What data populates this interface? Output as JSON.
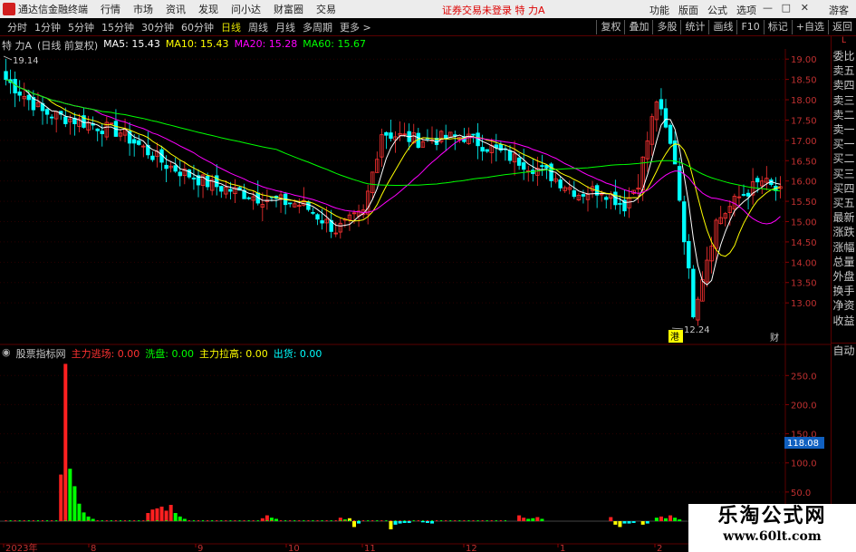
{
  "titlebar": {
    "app_title": "通达信金融终端",
    "menus": [
      "行情",
      "市场",
      "资讯",
      "发现",
      "问小达",
      "财富圈",
      "交易"
    ],
    "status": "证券交易未登录  特 力A",
    "right_menus": [
      "功能",
      "版面",
      "公式",
      "选项"
    ],
    "guest": "游客"
  },
  "toolbar": {
    "periods": [
      "分时",
      "1分钟",
      "5分钟",
      "15分钟",
      "30分钟",
      "60分钟",
      "日线",
      "周线",
      "月线",
      "多周期",
      "更多 >"
    ],
    "active_period": "日线",
    "right_tools": [
      "复权",
      "叠加",
      "多股",
      "统计",
      "画线",
      "F10",
      "标记",
      "+自选",
      "返回"
    ]
  },
  "main_chart": {
    "stock": "特 力A",
    "adjust": "(日线 前复权)",
    "ma5": "MA5: 15.43",
    "ma10": "MA10: 15.43",
    "ma20": "MA20: 15.28",
    "ma60": "MA60: 15.67",
    "high_label": "19.14",
    "low_label": "12.24",
    "finance_label": "财",
    "badge": "港",
    "price_ticks": [
      "19.00",
      "18.50",
      "18.00",
      "17.50",
      "17.00",
      "16.50",
      "16.00",
      "15.50",
      "15.00",
      "14.50",
      "14.00",
      "13.50",
      "13.00"
    ]
  },
  "sub_chart": {
    "indicator": "股票指标网",
    "main_fight": "主力逃场: 0.00",
    "wash": "洗盘: 0.00",
    "pull_up": "主力拉高: 0.00",
    "ship": "出货: 0.00",
    "ticks": [
      "250.0",
      "200.0",
      "150.0",
      "100.0",
      "50.0"
    ],
    "current_value": "118.08"
  },
  "x_axis": {
    "labels": [
      "2023年",
      "8",
      "9",
      "10",
      "11",
      "12",
      "1",
      "2"
    ]
  },
  "side_panel": {
    "top_label": "L",
    "items": [
      "委比",
      "卖五",
      "卖四",
      "卖三",
      "卖二",
      "卖一",
      "买一",
      "买二",
      "买三",
      "买四",
      "买五",
      "最新",
      "涨跌",
      "涨幅",
      "总量",
      "外盘",
      "换手",
      "净资",
      "收益"
    ],
    "bottom": "自动"
  },
  "watermark": {
    "title": "乐淘公式网",
    "url": "www.60lt.com"
  },
  "colors": {
    "up": "#ff3232",
    "down": "#00ffff",
    "ma5": "#ffffff",
    "ma10": "#ffff00",
    "ma20": "#ff00ff",
    "ma60": "#00ff00",
    "grid": "#5a0000"
  },
  "chart_data": [
    {
      "type": "candlestick",
      "title": "特 力A (日线 前复权)",
      "ylim": [
        12.24,
        19.14
      ],
      "series": [
        {
          "name": "MA5",
          "value": 15.43
        },
        {
          "name": "MA10",
          "value": 15.43
        },
        {
          "name": "MA20",
          "value": 15.28
        },
        {
          "name": "MA60",
          "value": 15.67
        }
      ],
      "x": [
        "2023年",
        "8",
        "9",
        "10",
        "11",
        "12",
        "1",
        "2"
      ],
      "high": 19.14,
      "low": 12.24
    },
    {
      "type": "bar",
      "title": "股票指标网",
      "ylim": [
        0,
        280
      ],
      "categories": [
        "2023年",
        "8",
        "9",
        "10",
        "11",
        "12",
        "1",
        "2"
      ],
      "current": 118.08
    }
  ]
}
